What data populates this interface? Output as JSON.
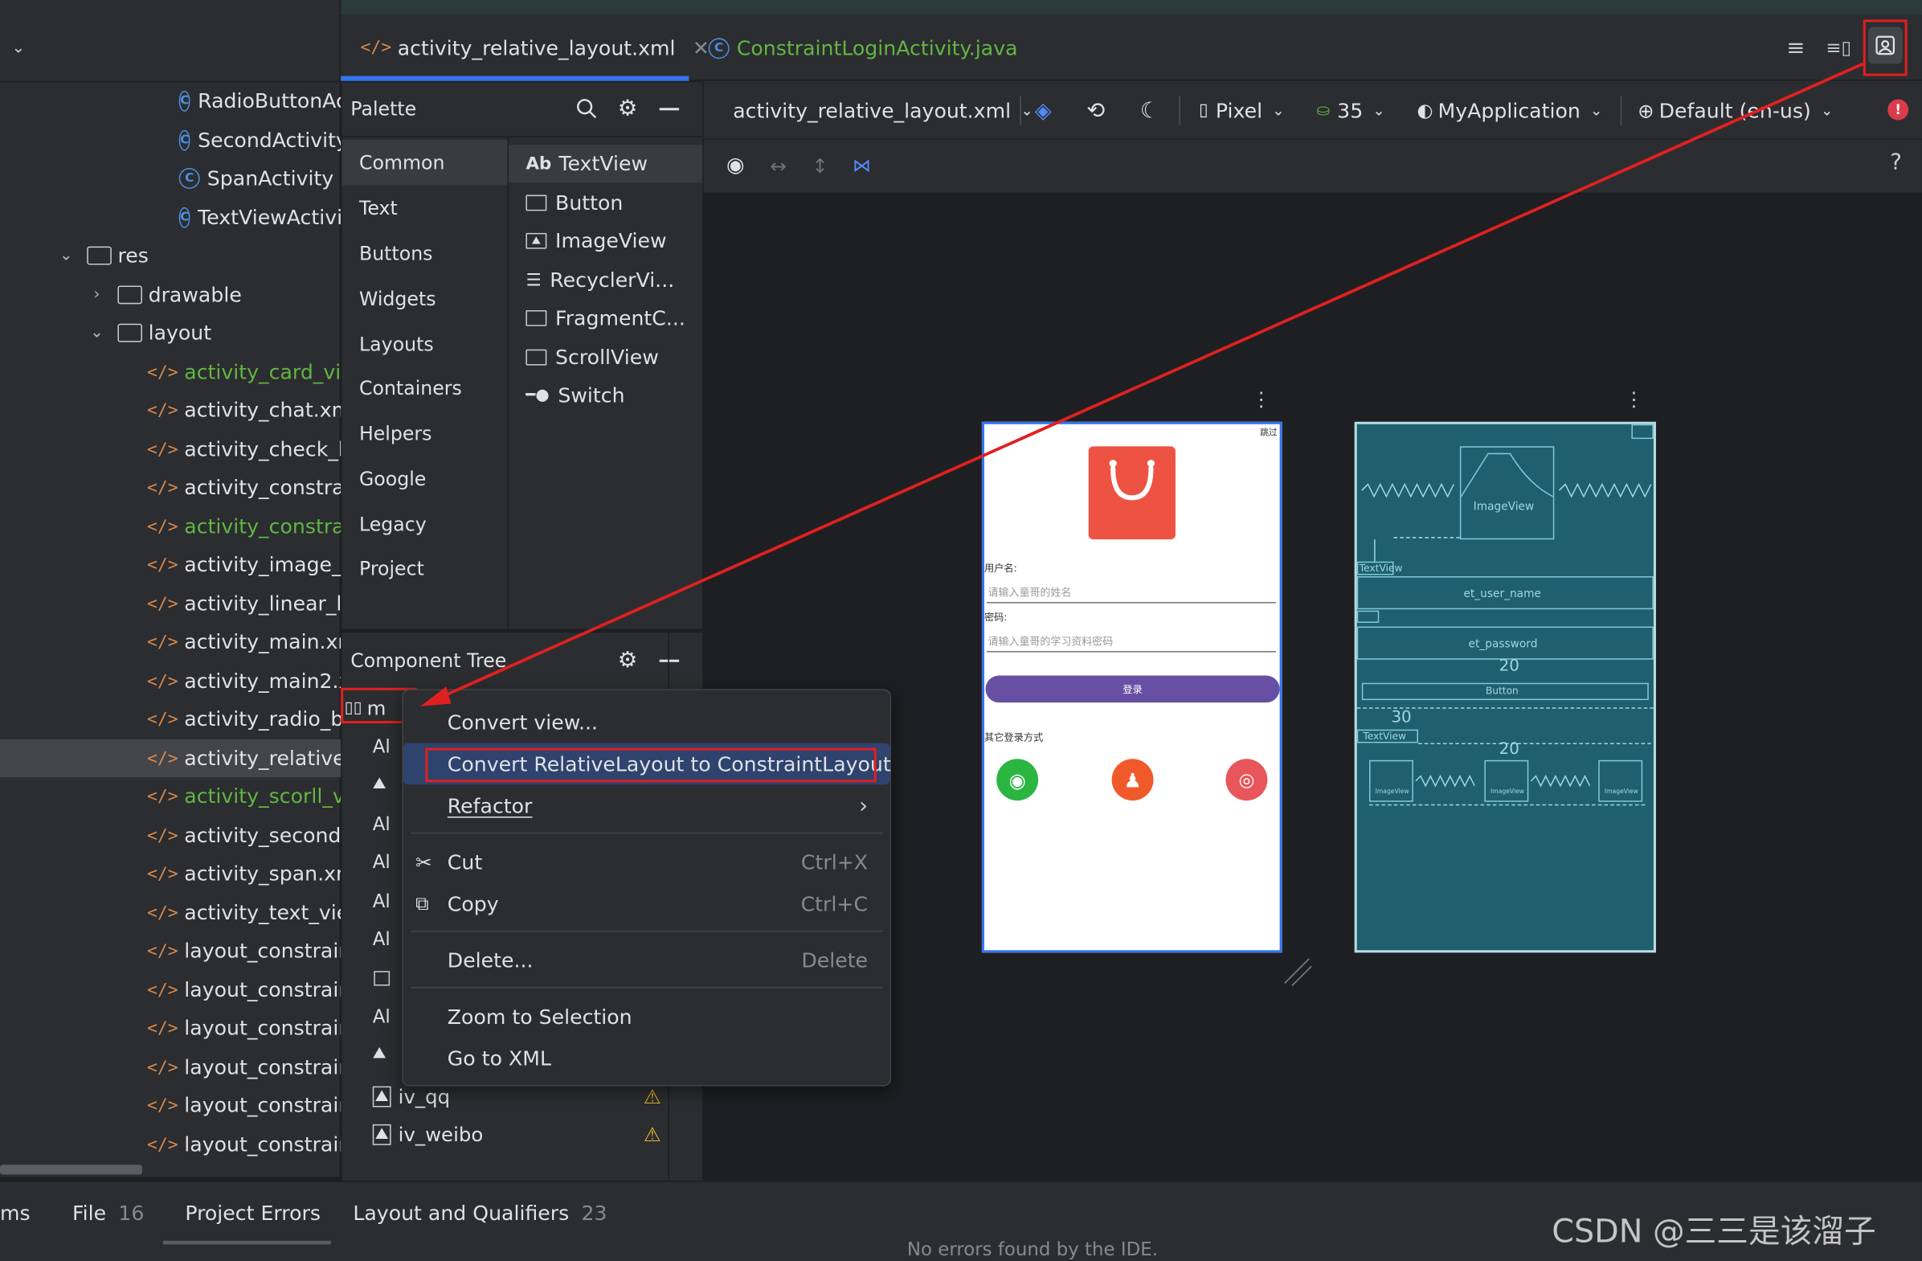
{
  "project_tree": {
    "items": [
      {
        "label": "RadioButtonActivity",
        "kind": "class"
      },
      {
        "label": "SecondActivity",
        "kind": "class"
      },
      {
        "label": "SpanActivity",
        "kind": "class"
      },
      {
        "label": "TextViewActivity",
        "kind": "class"
      },
      {
        "label": "res",
        "kind": "folder"
      },
      {
        "label": "drawable",
        "kind": "folder"
      },
      {
        "label": "layout",
        "kind": "folder"
      },
      {
        "label": "activity_card_view.xml",
        "kind": "xml"
      },
      {
        "label": "activity_chat.xml",
        "kind": "xml"
      },
      {
        "label": "activity_check_box.xml",
        "kind": "xml"
      },
      {
        "label": "activity_constraint.xml",
        "kind": "xml"
      },
      {
        "label": "activity_constraint_login.xml",
        "kind": "xml"
      },
      {
        "label": "activity_image_view.xml",
        "kind": "xml"
      },
      {
        "label": "activity_linear_layout.xml",
        "kind": "xml"
      },
      {
        "label": "activity_main.xml",
        "kind": "xml"
      },
      {
        "label": "activity_main2.xml",
        "kind": "xml"
      },
      {
        "label": "activity_radio_button.xml",
        "kind": "xml"
      },
      {
        "label": "activity_relative_layout.xml",
        "kind": "xml"
      },
      {
        "label": "activity_scorll_view.xml",
        "kind": "xml"
      },
      {
        "label": "activity_second.xml",
        "kind": "xml"
      },
      {
        "label": "activity_span.xml",
        "kind": "xml"
      },
      {
        "label": "activity_text_view.xml",
        "kind": "xml"
      },
      {
        "label": "layout_constraint_",
        "kind": "xml"
      },
      {
        "label": "layout_constraint_",
        "kind": "xml"
      },
      {
        "label": "layout_constraint_",
        "kind": "xml"
      },
      {
        "label": "layout_constraint_",
        "kind": "xml"
      },
      {
        "label": "layout_constraint_",
        "kind": "xml"
      },
      {
        "label": "layout_constraint_",
        "kind": "xml"
      }
    ]
  },
  "tabs": [
    {
      "label": "activity_relative_layout.xml",
      "active": true
    },
    {
      "label": "ConstraintLoginActivity.java",
      "active": false
    }
  ],
  "palette": {
    "title": "Palette",
    "categories": [
      "Common",
      "Text",
      "Buttons",
      "Widgets",
      "Layouts",
      "Containers",
      "Helpers",
      "Google",
      "Legacy",
      "Project"
    ],
    "widgets": [
      "TextView",
      "Button",
      "ImageView",
      "RecyclerVi...",
      "FragmentC...",
      "ScrollView",
      "Switch"
    ],
    "textview_prefix": "Ab"
  },
  "component_tree": {
    "title": "Component Tree",
    "root_label": "m",
    "rows": [
      "Al",
      "",
      "Al",
      "Al",
      "Al",
      "Al",
      "",
      "Al",
      "",
      "iv_qq",
      "iv_weibo"
    ]
  },
  "design_toolbar": {
    "file": "activity_relative_layout.xml",
    "device": "Pixel",
    "api": "35",
    "theme": "MyApplication",
    "locale": "Default (en-us)",
    "help": "?"
  },
  "context_menu": {
    "items": [
      {
        "label": "Convert view...",
        "shortcut": ""
      },
      {
        "label": "Convert RelativeLayout to ConstraintLayout",
        "shortcut": "",
        "highlighted": true
      },
      {
        "label": "Refactor",
        "shortcut": "›"
      },
      {
        "label": "Cut",
        "shortcut": "Ctrl+X"
      },
      {
        "label": "Copy",
        "shortcut": "Ctrl+C"
      },
      {
        "label": "Delete...",
        "shortcut": "Delete"
      },
      {
        "label": "Zoom to Selection",
        "shortcut": ""
      },
      {
        "label": "Go to XML",
        "shortcut": ""
      }
    ]
  },
  "phone_preview": {
    "skip": "跳过",
    "username_label": "用户名:",
    "username_hint": "请输入童哥的姓名",
    "password_label": "密码:",
    "password_hint": "请输入童哥的学习资料密码",
    "login_button": "登录",
    "other_login": "其它登录方式"
  },
  "blueprint": {
    "imageview": "ImageView",
    "textview": "TextView",
    "et_user_name": "et_user_name",
    "et_password": "et_password",
    "button": "Button",
    "margin_20a": "20",
    "margin_30": "30",
    "margin_20b": "20",
    "small_label": "ImageView"
  },
  "bottom_bar": {
    "tabs": [
      {
        "label": "ms",
        "count": ""
      },
      {
        "label": "File",
        "count": "16"
      },
      {
        "label": "Project Errors",
        "count": ""
      },
      {
        "label": "Layout and Qualifiers",
        "count": "23"
      }
    ],
    "status": "No errors found by the IDE."
  },
  "watermark": "CSDN @三三是该溜子",
  "colors": {
    "accent": "#3574f0",
    "annotation_red": "#e02020",
    "login_button": "#6750a4",
    "shopping_bag": "#ee5242",
    "wechat": "#2bb541",
    "qq": "#f05a2a",
    "weibo": "#e8555a",
    "blueprint_bg": "#1f5f6e"
  }
}
